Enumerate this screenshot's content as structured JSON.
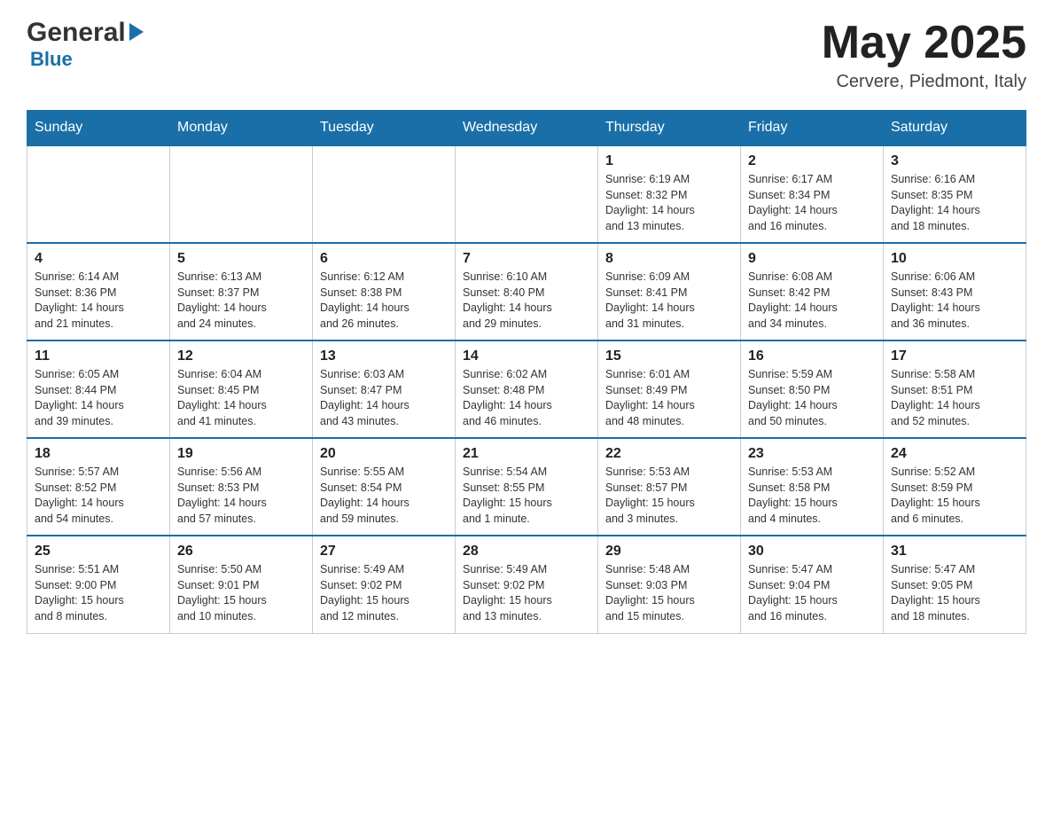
{
  "logo": {
    "general": "General",
    "arrow": "▶",
    "blue": "Blue"
  },
  "title": {
    "month_year": "May 2025",
    "location": "Cervere, Piedmont, Italy"
  },
  "days_of_week": [
    "Sunday",
    "Monday",
    "Tuesday",
    "Wednesday",
    "Thursday",
    "Friday",
    "Saturday"
  ],
  "weeks": [
    [
      {
        "day": "",
        "info": ""
      },
      {
        "day": "",
        "info": ""
      },
      {
        "day": "",
        "info": ""
      },
      {
        "day": "",
        "info": ""
      },
      {
        "day": "1",
        "info": "Sunrise: 6:19 AM\nSunset: 8:32 PM\nDaylight: 14 hours\nand 13 minutes."
      },
      {
        "day": "2",
        "info": "Sunrise: 6:17 AM\nSunset: 8:34 PM\nDaylight: 14 hours\nand 16 minutes."
      },
      {
        "day": "3",
        "info": "Sunrise: 6:16 AM\nSunset: 8:35 PM\nDaylight: 14 hours\nand 18 minutes."
      }
    ],
    [
      {
        "day": "4",
        "info": "Sunrise: 6:14 AM\nSunset: 8:36 PM\nDaylight: 14 hours\nand 21 minutes."
      },
      {
        "day": "5",
        "info": "Sunrise: 6:13 AM\nSunset: 8:37 PM\nDaylight: 14 hours\nand 24 minutes."
      },
      {
        "day": "6",
        "info": "Sunrise: 6:12 AM\nSunset: 8:38 PM\nDaylight: 14 hours\nand 26 minutes."
      },
      {
        "day": "7",
        "info": "Sunrise: 6:10 AM\nSunset: 8:40 PM\nDaylight: 14 hours\nand 29 minutes."
      },
      {
        "day": "8",
        "info": "Sunrise: 6:09 AM\nSunset: 8:41 PM\nDaylight: 14 hours\nand 31 minutes."
      },
      {
        "day": "9",
        "info": "Sunrise: 6:08 AM\nSunset: 8:42 PM\nDaylight: 14 hours\nand 34 minutes."
      },
      {
        "day": "10",
        "info": "Sunrise: 6:06 AM\nSunset: 8:43 PM\nDaylight: 14 hours\nand 36 minutes."
      }
    ],
    [
      {
        "day": "11",
        "info": "Sunrise: 6:05 AM\nSunset: 8:44 PM\nDaylight: 14 hours\nand 39 minutes."
      },
      {
        "day": "12",
        "info": "Sunrise: 6:04 AM\nSunset: 8:45 PM\nDaylight: 14 hours\nand 41 minutes."
      },
      {
        "day": "13",
        "info": "Sunrise: 6:03 AM\nSunset: 8:47 PM\nDaylight: 14 hours\nand 43 minutes."
      },
      {
        "day": "14",
        "info": "Sunrise: 6:02 AM\nSunset: 8:48 PM\nDaylight: 14 hours\nand 46 minutes."
      },
      {
        "day": "15",
        "info": "Sunrise: 6:01 AM\nSunset: 8:49 PM\nDaylight: 14 hours\nand 48 minutes."
      },
      {
        "day": "16",
        "info": "Sunrise: 5:59 AM\nSunset: 8:50 PM\nDaylight: 14 hours\nand 50 minutes."
      },
      {
        "day": "17",
        "info": "Sunrise: 5:58 AM\nSunset: 8:51 PM\nDaylight: 14 hours\nand 52 minutes."
      }
    ],
    [
      {
        "day": "18",
        "info": "Sunrise: 5:57 AM\nSunset: 8:52 PM\nDaylight: 14 hours\nand 54 minutes."
      },
      {
        "day": "19",
        "info": "Sunrise: 5:56 AM\nSunset: 8:53 PM\nDaylight: 14 hours\nand 57 minutes."
      },
      {
        "day": "20",
        "info": "Sunrise: 5:55 AM\nSunset: 8:54 PM\nDaylight: 14 hours\nand 59 minutes."
      },
      {
        "day": "21",
        "info": "Sunrise: 5:54 AM\nSunset: 8:55 PM\nDaylight: 15 hours\nand 1 minute."
      },
      {
        "day": "22",
        "info": "Sunrise: 5:53 AM\nSunset: 8:57 PM\nDaylight: 15 hours\nand 3 minutes."
      },
      {
        "day": "23",
        "info": "Sunrise: 5:53 AM\nSunset: 8:58 PM\nDaylight: 15 hours\nand 4 minutes."
      },
      {
        "day": "24",
        "info": "Sunrise: 5:52 AM\nSunset: 8:59 PM\nDaylight: 15 hours\nand 6 minutes."
      }
    ],
    [
      {
        "day": "25",
        "info": "Sunrise: 5:51 AM\nSunset: 9:00 PM\nDaylight: 15 hours\nand 8 minutes."
      },
      {
        "day": "26",
        "info": "Sunrise: 5:50 AM\nSunset: 9:01 PM\nDaylight: 15 hours\nand 10 minutes."
      },
      {
        "day": "27",
        "info": "Sunrise: 5:49 AM\nSunset: 9:02 PM\nDaylight: 15 hours\nand 12 minutes."
      },
      {
        "day": "28",
        "info": "Sunrise: 5:49 AM\nSunset: 9:02 PM\nDaylight: 15 hours\nand 13 minutes."
      },
      {
        "day": "29",
        "info": "Sunrise: 5:48 AM\nSunset: 9:03 PM\nDaylight: 15 hours\nand 15 minutes."
      },
      {
        "day": "30",
        "info": "Sunrise: 5:47 AM\nSunset: 9:04 PM\nDaylight: 15 hours\nand 16 minutes."
      },
      {
        "day": "31",
        "info": "Sunrise: 5:47 AM\nSunset: 9:05 PM\nDaylight: 15 hours\nand 18 minutes."
      }
    ]
  ]
}
